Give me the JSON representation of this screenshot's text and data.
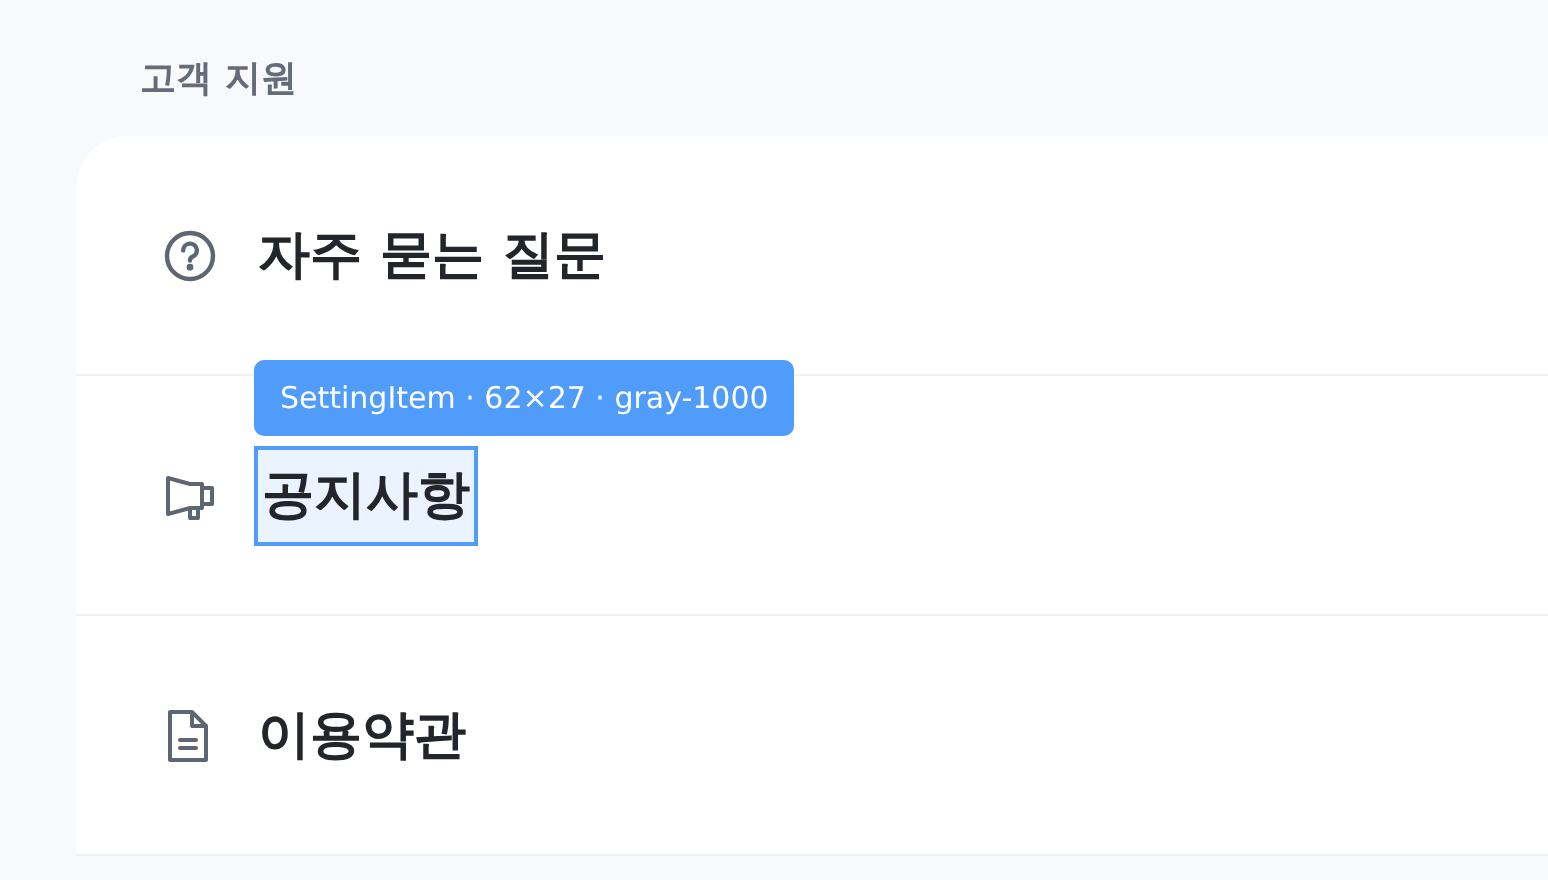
{
  "section_title": "고객 지원",
  "items": [
    {
      "kind": "question",
      "label": "자주 묻는 질문",
      "inspected": false
    },
    {
      "kind": "megaphone",
      "label": "공지사항",
      "inspected": true
    },
    {
      "kind": "document",
      "label": "이용약관",
      "inspected": false
    }
  ],
  "inspector": {
    "label": "SettingItem · 62×27 · gray-1000"
  }
}
